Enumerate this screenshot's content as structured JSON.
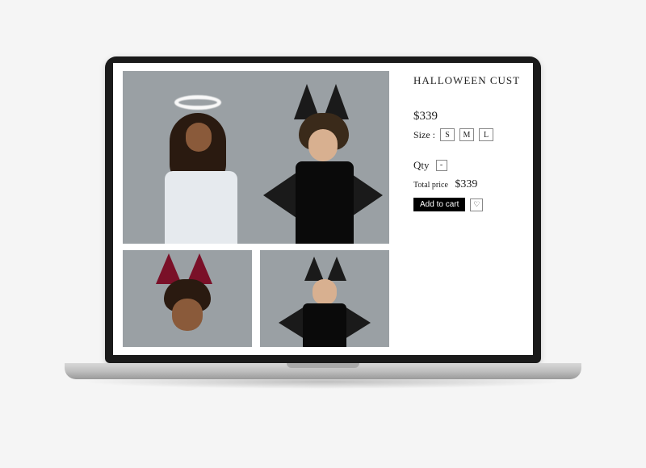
{
  "product": {
    "title": "HALLOWEEN CUST",
    "price": "$339",
    "size_label": "Size :",
    "sizes": [
      "S",
      "M",
      "L"
    ],
    "qty_label": "Qty",
    "qty_minus": "-",
    "total_label": "Total price",
    "total_price": "$339",
    "add_to_cart": "Add to cart",
    "wishlist_icon": "♡"
  }
}
